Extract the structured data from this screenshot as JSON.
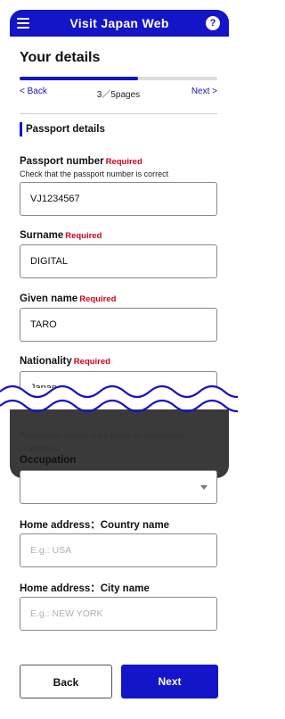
{
  "app": {
    "title": "Visit Japan Web",
    "help_label": "?"
  },
  "page": {
    "title": "Your details",
    "progress": 0.6
  },
  "nav": {
    "back": "< Back",
    "pages": "3／5pages",
    "next": "Next >"
  },
  "section": {
    "title": "Passport details"
  },
  "fields": {
    "passport": {
      "label": "Passport number",
      "required": "Required",
      "hint": "Check that the passport number is correct",
      "value": "VJ1234567"
    },
    "surname": {
      "label": "Surname",
      "required": "Required",
      "value": "DIGITAL"
    },
    "given": {
      "label": "Given name",
      "required": "Required",
      "value": "TARO"
    },
    "nationality": {
      "label": "Nationality",
      "required": "Required",
      "value": "Japan"
    }
  },
  "lower": {
    "registration_text_1": "Registration makes entry easier in subsequent",
    "registration_text_2": "procedures",
    "occupation_label": "Occupation",
    "home_country_label": "Home address：Country name",
    "home_country_placeholder": "E.g.: USA",
    "home_city_label": "Home address：City name",
    "home_city_placeholder": "E.g.: NEW YORK"
  },
  "buttons": {
    "back": "Back",
    "next": "Next"
  },
  "colors": {
    "brand": "#1414c8",
    "required": "#d6001c",
    "frame": "#3a3a3a"
  }
}
